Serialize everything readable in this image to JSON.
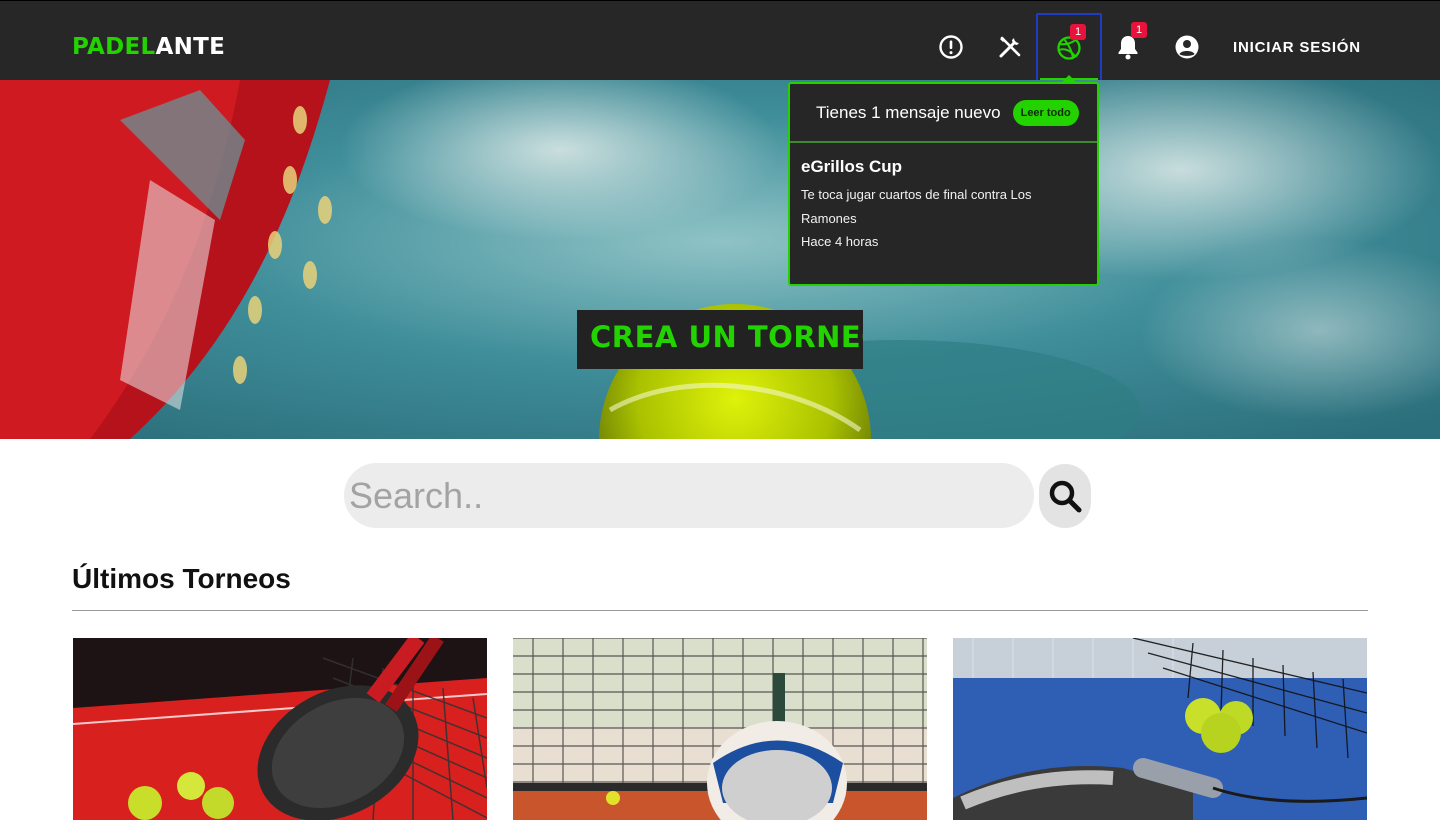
{
  "header": {
    "brand_part1": "PADEL",
    "brand_part2": "ANTE",
    "login_label": "INICIAR SESIÓN",
    "icons": [
      {
        "name": "alert-icon",
        "badge": ""
      },
      {
        "name": "tools-icon",
        "badge": ""
      },
      {
        "name": "ball-icon",
        "badge": "1",
        "active": true
      },
      {
        "name": "bell-icon",
        "badge": "1"
      },
      {
        "name": "user-icon",
        "badge": ""
      }
    ]
  },
  "hero": {
    "cta_label": "CREA UN TORNEO"
  },
  "notifications": {
    "header_text": "Tienes 1 mensaje nuevo",
    "read_all_label": "Leer todo",
    "items": [
      {
        "title": "eGrillos Cup",
        "message": "Te toca jugar cuartos de final contra Los Ramones",
        "time": "Hace 4 horas"
      }
    ]
  },
  "search": {
    "placeholder": "Search.."
  },
  "section": {
    "title": "Últimos Torneos"
  },
  "colors": {
    "accent": "#22d300",
    "navbar": "#272727",
    "badge": "#e8123a",
    "active_border": "#1e3cc4"
  }
}
